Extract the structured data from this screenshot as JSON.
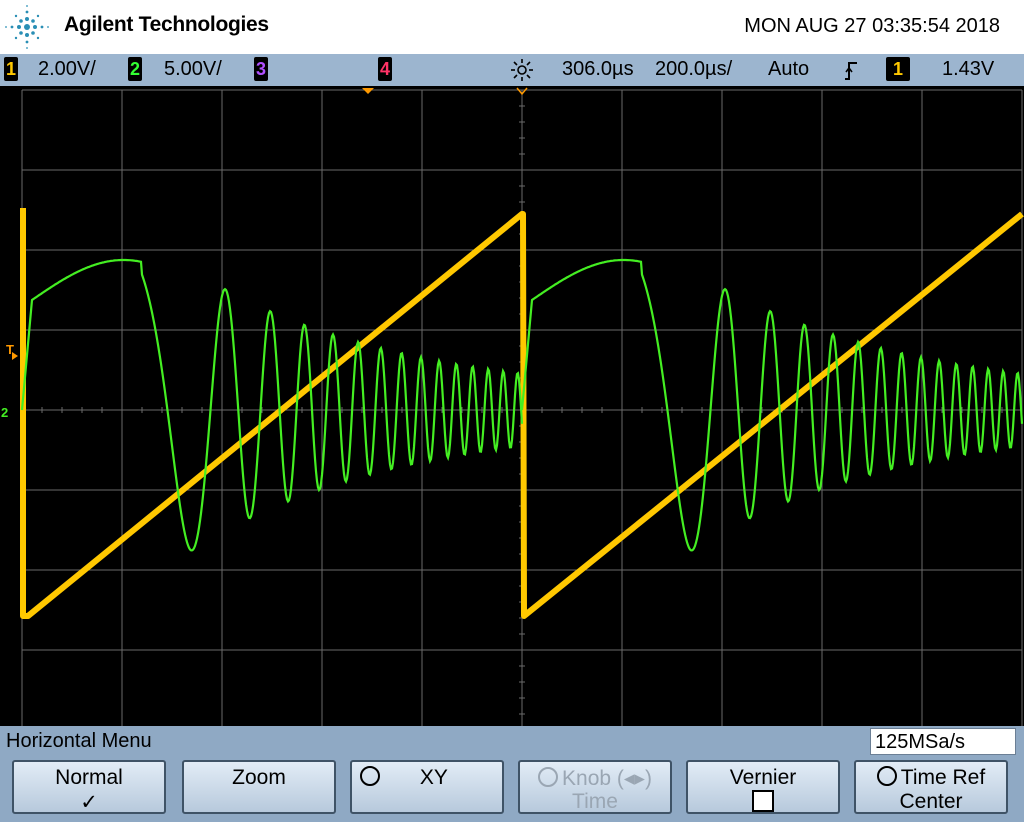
{
  "header": {
    "brand": "Agilent Technologies",
    "datetime": "MON AUG 27 03:35:54 2018"
  },
  "status": {
    "ch1": {
      "num": "1",
      "scale": "2.00V/",
      "color": "#ffc800"
    },
    "ch2": {
      "num": "2",
      "scale": "5.00V/",
      "color": "#33ff33"
    },
    "ch3": {
      "num": "3",
      "color": "#b050ff"
    },
    "ch4": {
      "num": "4",
      "color": "#ff3366"
    },
    "delay": "306.0µs",
    "timebase": "200.0µs/",
    "trigger_mode": "Auto",
    "trigger_slope": "↑",
    "trigger_source": "1",
    "trigger_level": "1.43V"
  },
  "screen": {
    "trigger_marker": "T",
    "ch1_marker": "1",
    "ch2_marker": "2",
    "colors": {
      "ch1": "#ffc800",
      "ch2": "#44ee22",
      "grid": "#6a6a6a",
      "ground": "#ff9900"
    }
  },
  "menu": {
    "title": "Horizontal Menu",
    "sample_rate": "125MSa/s",
    "softkeys": [
      {
        "line1": "Normal",
        "line2": "✓"
      },
      {
        "line1": "Zoom",
        "line2": ""
      },
      {
        "line1": "XY",
        "line2": ""
      },
      {
        "line1": "Knob (◂▸)",
        "line2": "Time"
      },
      {
        "line1": "Vernier",
        "line2": ""
      },
      {
        "line1": "Time Ref",
        "line2": "Center"
      }
    ]
  }
}
